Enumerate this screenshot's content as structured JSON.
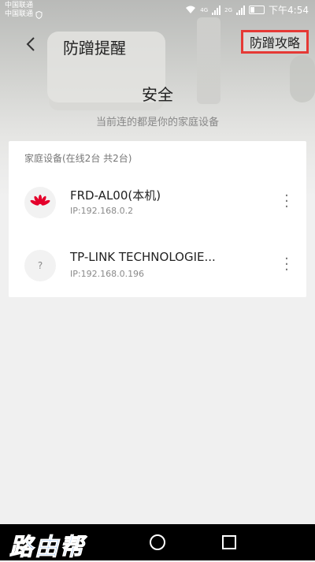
{
  "status_bar": {
    "carrier1": "中国联通",
    "carrier2": "中国联通",
    "time": "下午4:54",
    "net1": "4G",
    "net2": "2G"
  },
  "header": {
    "title": "防蹭提醒",
    "guide_button": "防蹭攻略"
  },
  "summary": {
    "status": "安全",
    "subtitle": "当前连的都是你的家庭设备"
  },
  "devices_card": {
    "title": "家庭设备(在线2台 共2台)",
    "devices": [
      {
        "name": "FRD-AL00(本机)",
        "ip": "IP:192.168.0.2",
        "icon": "huawei-logo-icon"
      },
      {
        "name": "TP-LINK TECHNOLOGIE...",
        "ip": "IP:192.168.0.196",
        "icon": "unknown-device-icon",
        "avatar_text": "?"
      }
    ]
  },
  "watermark": "路由帮",
  "colors": {
    "highlight_border": "#e53935",
    "huawei_red": "#e4002b",
    "watermark_blue": "#1e73d8"
  }
}
